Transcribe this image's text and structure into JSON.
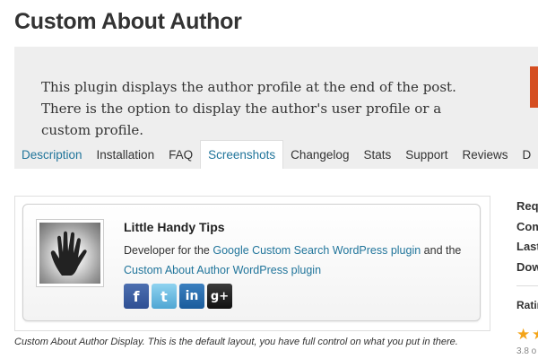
{
  "page": {
    "title": "Custom About Author",
    "description": "This plugin displays the author profile at the end of the post. There is the option to display the author's user profile or a custom profile."
  },
  "tabs": [
    {
      "label": "Description",
      "active": false
    },
    {
      "label": "Installation",
      "active": false
    },
    {
      "label": "FAQ",
      "active": false
    },
    {
      "label": "Screenshots",
      "active": true
    },
    {
      "label": "Changelog",
      "active": false
    },
    {
      "label": "Stats",
      "active": false
    },
    {
      "label": "Support",
      "active": false
    },
    {
      "label": "Reviews",
      "active": false
    },
    {
      "label": "D",
      "active": false
    }
  ],
  "screenshot": {
    "author_name": "Little Handy Tips",
    "bio_prefix": "Developer for the ",
    "bio_link1": "Google Custom Search WordPress plugin",
    "bio_mid": " and the ",
    "bio_link2": "Custom About Author WordPress plugin",
    "social_icons": [
      {
        "icon": "facebook-icon",
        "glyph": "f"
      },
      {
        "icon": "twitter-icon",
        "glyph": "t"
      },
      {
        "icon": "linkedin-icon",
        "glyph": "in"
      },
      {
        "icon": "google-plus-icon",
        "glyph": "g+"
      }
    ],
    "caption": "Custom About Author Display. This is the default layout, you have full control on what you put in there."
  },
  "sidebar": {
    "labels": [
      "Req",
      "Com",
      "Last",
      "Dow"
    ],
    "ratings_label": "Ratin",
    "rating_value": "3.8 o"
  },
  "colors": {
    "link": "#21759b",
    "header_bg": "#eeeeee",
    "download_button": "#d54e21",
    "star": "#f4a418"
  }
}
